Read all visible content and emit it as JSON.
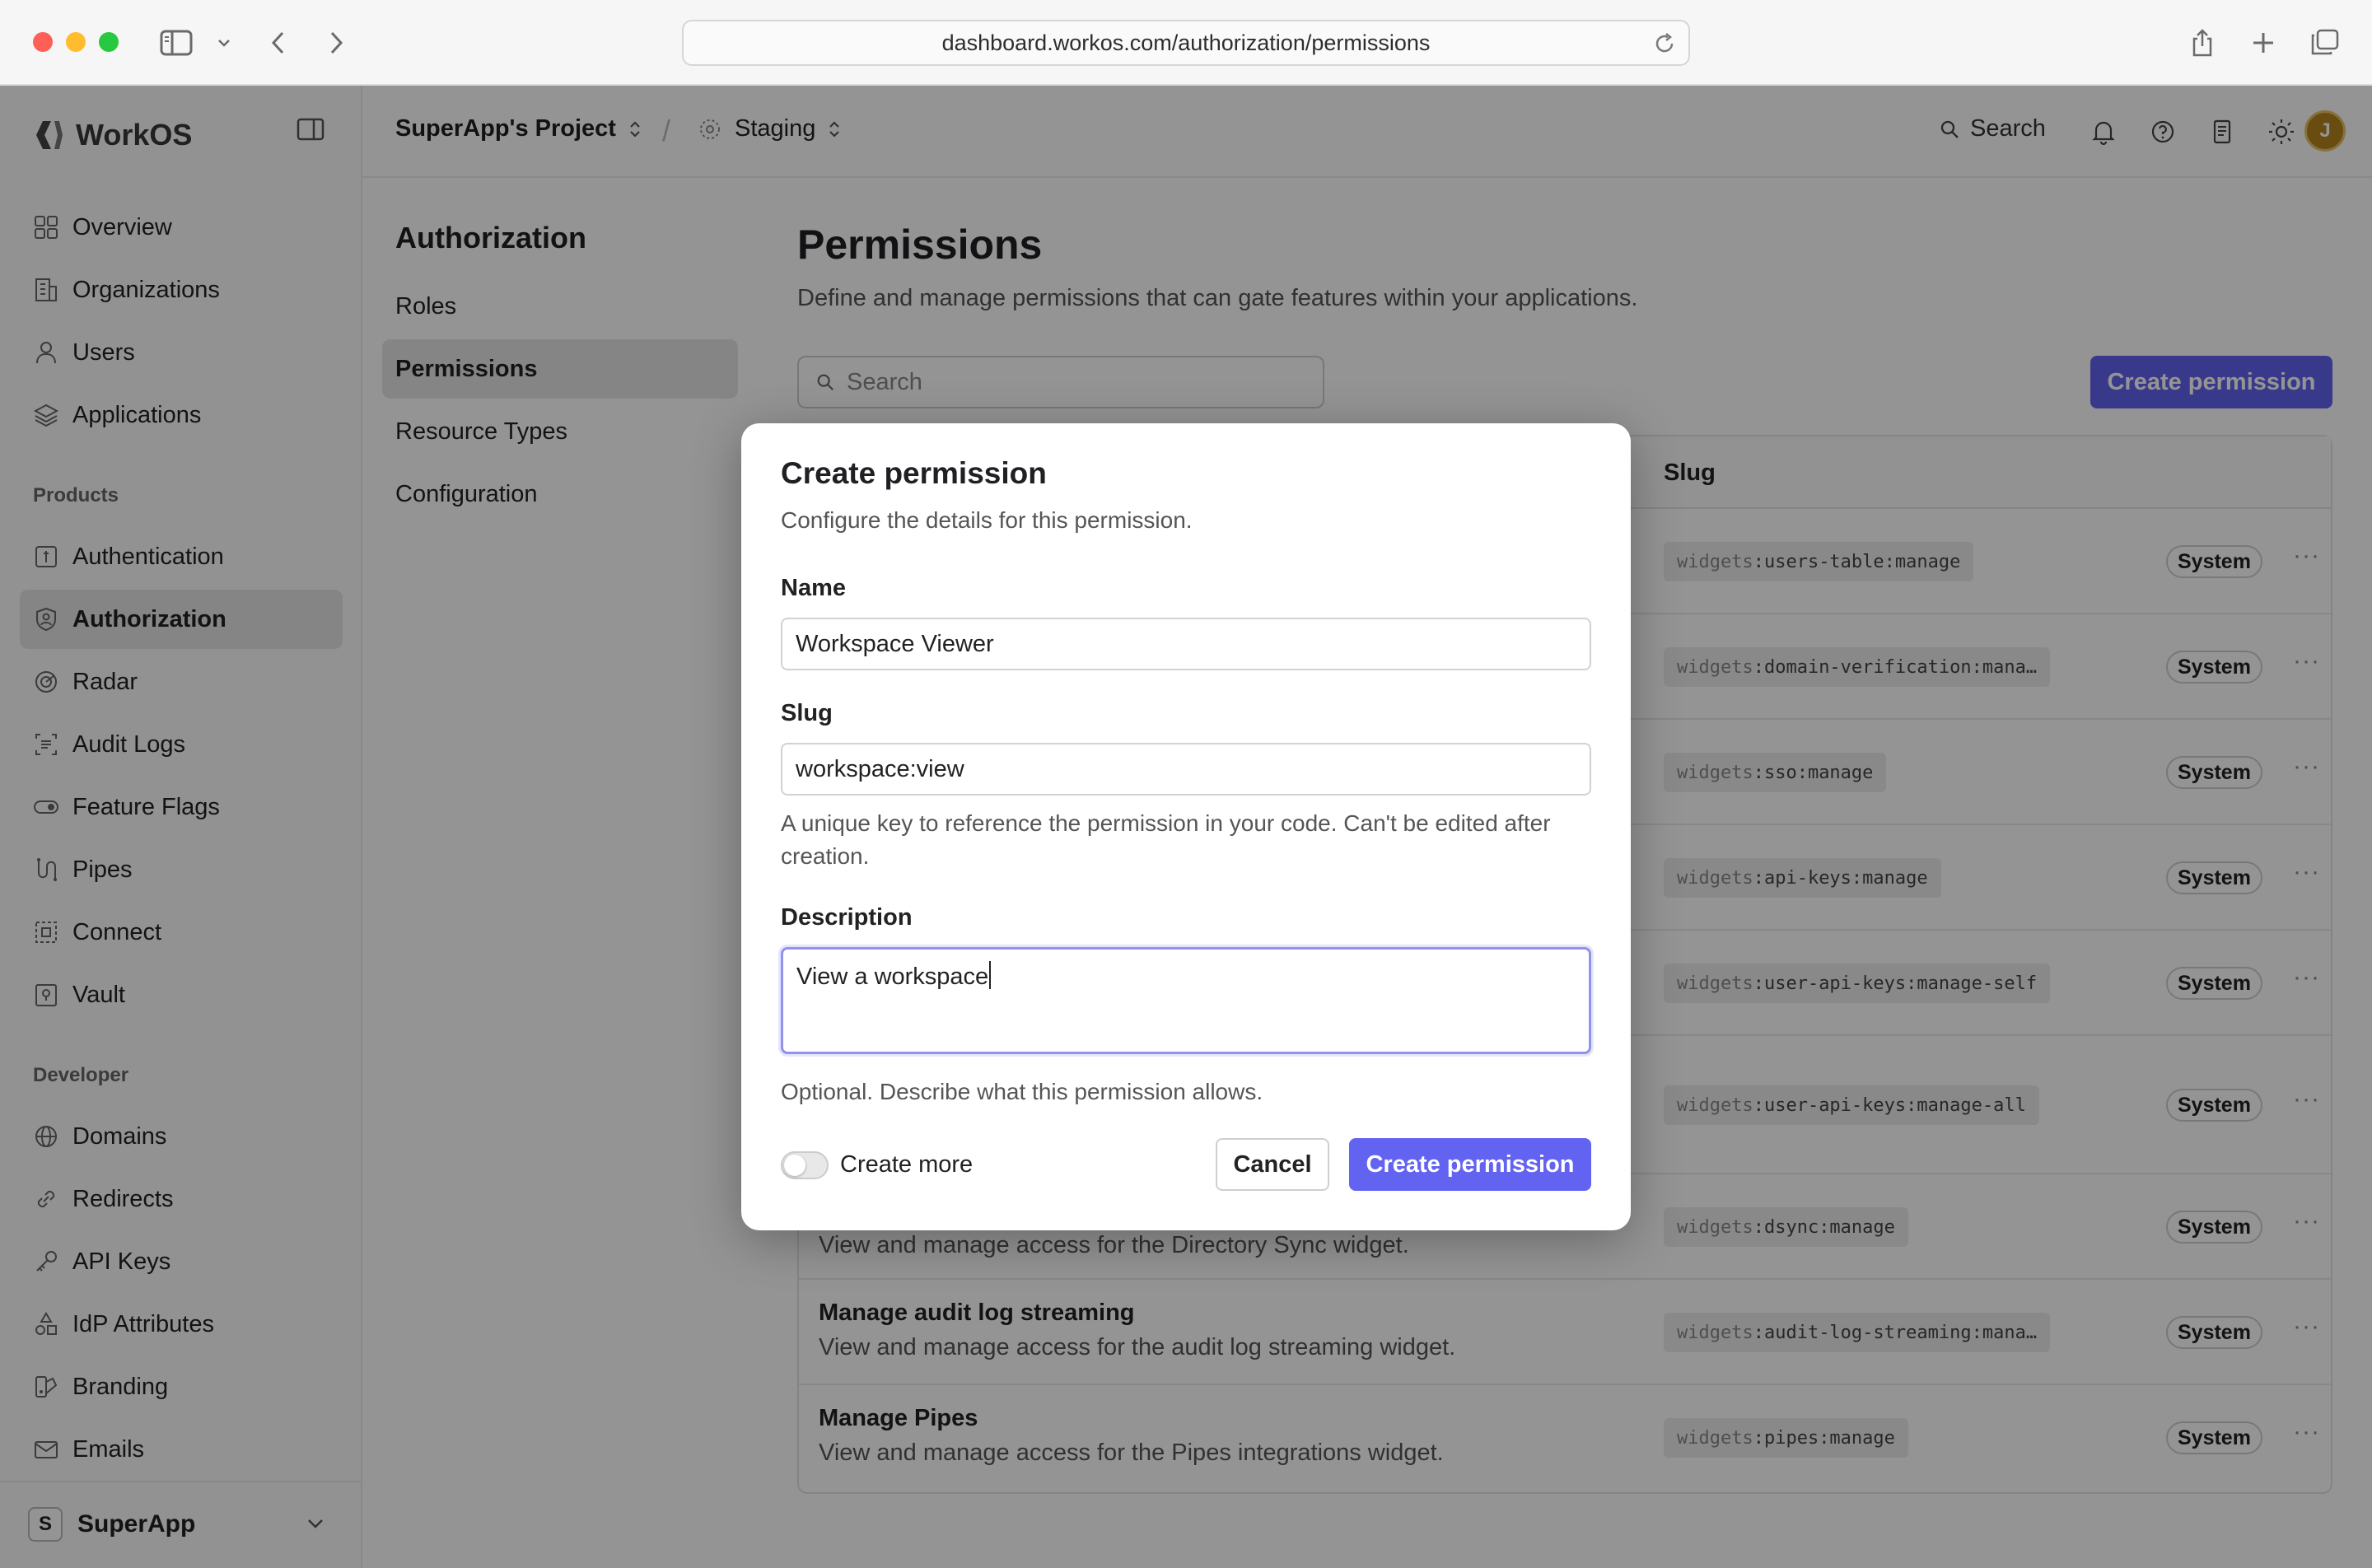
{
  "browser": {
    "url": "dashboard.workos.com/authorization/permissions"
  },
  "brand": {
    "name": "WorkOS"
  },
  "topbar": {
    "project": "SuperApp's Project",
    "environment": "Staging",
    "search_label": "Search",
    "avatar_initial": "J"
  },
  "sidebar": {
    "main": [
      {
        "label": "Overview",
        "icon": "grid-icon"
      },
      {
        "label": "Organizations",
        "icon": "building-icon"
      },
      {
        "label": "Users",
        "icon": "user-icon"
      },
      {
        "label": "Applications",
        "icon": "layers-icon"
      }
    ],
    "products_heading": "Products",
    "products": [
      {
        "label": "Authentication",
        "icon": "key-square-icon"
      },
      {
        "label": "Authorization",
        "icon": "shield-user-icon",
        "active": true
      },
      {
        "label": "Radar",
        "icon": "radar-icon"
      },
      {
        "label": "Audit Logs",
        "icon": "audit-icon"
      },
      {
        "label": "Feature Flags",
        "icon": "toggle-icon"
      },
      {
        "label": "Pipes",
        "icon": "pipes-icon"
      },
      {
        "label": "Connect",
        "icon": "connect-icon"
      },
      {
        "label": "Vault",
        "icon": "vault-icon"
      }
    ],
    "developer_heading": "Developer",
    "developer": [
      {
        "label": "Domains",
        "icon": "globe-icon"
      },
      {
        "label": "Redirects",
        "icon": "link-icon"
      },
      {
        "label": "API Keys",
        "icon": "key-icon"
      },
      {
        "label": "IdP Attributes",
        "icon": "shapes-icon"
      },
      {
        "label": "Branding",
        "icon": "palette-icon"
      },
      {
        "label": "Emails",
        "icon": "mail-icon"
      }
    ],
    "org_switcher": {
      "initial": "S",
      "name": "SuperApp"
    }
  },
  "subnav": {
    "title": "Authorization",
    "items": [
      {
        "label": "Roles"
      },
      {
        "label": "Permissions",
        "active": true
      },
      {
        "label": "Resource Types"
      },
      {
        "label": "Configuration"
      }
    ]
  },
  "page": {
    "title": "Permissions",
    "subtitle": "Define and manage permissions that can gate features within your applications.",
    "search_placeholder": "Search",
    "create_button": "Create permission"
  },
  "table": {
    "col_slug": "Slug",
    "rows": [
      {
        "name": "",
        "description": "",
        "slug_prefix": "widgets",
        "slug_rest": ":users-table:manage",
        "badge": "System"
      },
      {
        "name": "",
        "description": "",
        "slug_prefix": "widgets",
        "slug_rest": ":domain-verification:mana…",
        "badge": "System"
      },
      {
        "name": "",
        "description": "",
        "slug_prefix": "widgets",
        "slug_rest": ":sso:manage",
        "badge": "System"
      },
      {
        "name": "",
        "description": "",
        "slug_prefix": "widgets",
        "slug_rest": ":api-keys:manage",
        "badge": "System"
      },
      {
        "name": "",
        "description": "",
        "slug_prefix": "widgets",
        "slug_rest": ":user-api-keys:manage-self",
        "badge": "System"
      },
      {
        "name": "",
        "description": "",
        "slug_prefix": "widgets",
        "slug_rest": ":user-api-keys:manage-all",
        "badge": "System"
      },
      {
        "name": "",
        "description": "View and manage access for the Directory Sync widget.",
        "slug_prefix": "widgets",
        "slug_rest": ":dsync:manage",
        "badge": "System"
      },
      {
        "name": "Manage audit log streaming",
        "description": "View and manage access for the audit log streaming widget.",
        "slug_prefix": "widgets",
        "slug_rest": ":audit-log-streaming:mana…",
        "badge": "System"
      },
      {
        "name": "Manage Pipes",
        "description": "View and manage access for the Pipes integrations widget.",
        "slug_prefix": "widgets",
        "slug_rest": ":pipes:manage",
        "badge": "System"
      }
    ],
    "more_glyph": "···"
  },
  "modal": {
    "title": "Create permission",
    "subtitle": "Configure the details for this permission.",
    "name_label": "Name",
    "name_value": "Workspace Viewer",
    "slug_label": "Slug",
    "slug_value": "workspace:view",
    "slug_help": "A unique key to reference the permission in your code. Can't be edited after creation.",
    "description_label": "Description",
    "description_value": "View a workspace",
    "description_help": "Optional. Describe what this permission allows.",
    "create_more_label": "Create more",
    "create_more_on": false,
    "cancel_label": "Cancel",
    "submit_label": "Create permission"
  },
  "colors": {
    "primary": "#6363f1",
    "overlay": "rgba(0,0,0,0.42)"
  }
}
